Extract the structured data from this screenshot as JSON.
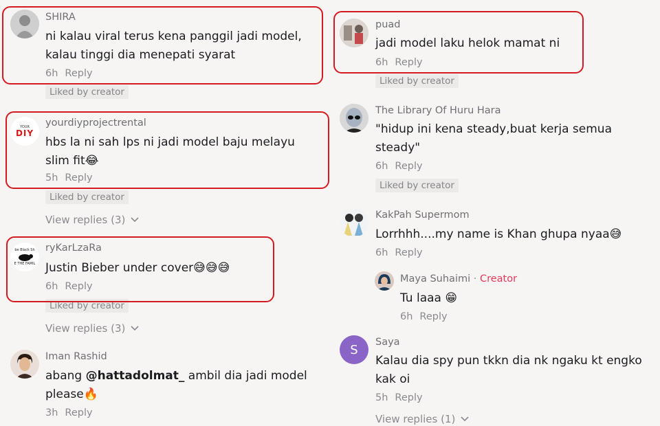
{
  "colors": {
    "highlight_border": "#d21a20",
    "creator_label": "#e5375a",
    "avatar_saya": "#8b64c8"
  },
  "left": [
    {
      "user": "SHIRA",
      "text": "ni kalau viral terus kena panggil jadi model, kalau tinggi dia menepati syarat",
      "time": "6h",
      "reply": "Reply",
      "liked": "Liked by creator"
    },
    {
      "user": "yourdiyprojectrental",
      "text": "hbs la ni sah lps ni jadi model baju melayu slim fit",
      "emoji": "😂",
      "time": "5h",
      "reply": "Reply",
      "liked": "Liked by creator",
      "view_replies": "View replies (3)"
    },
    {
      "user": "ryKarLzaRa",
      "text": "Justin Bieber under cover",
      "emoji": "😅😅😅",
      "time": "6h",
      "reply": "Reply",
      "liked": "Liked by creator",
      "view_replies": "View replies (3)"
    },
    {
      "user": "Iman Rashid",
      "text_pre": "abang ",
      "mention": "@hattadolmat_",
      "text_post": " ambil dia jadi model please",
      "emoji": "🔥",
      "time": "3h",
      "reply": "Reply"
    }
  ],
  "right": [
    {
      "user": "puad",
      "text": "jadi model laku helok mamat ni",
      "time": "6h",
      "reply": "Reply",
      "liked": "Liked by creator"
    },
    {
      "user": "The Library Of Huru Hara",
      "text": "\"hidup ini kena steady,buat kerja semua steady\"",
      "time": "6h",
      "reply": "Reply",
      "liked": "Liked by creator"
    },
    {
      "user": "KakPah Supermom",
      "text": "Lorrhhh....my name is Khan ghupa nyaa",
      "emoji": "😅",
      "time": "6h",
      "reply": "Reply"
    },
    {
      "user": "Maya Suhaimi",
      "dot": "·",
      "creator": "Creator",
      "text": "Tu laaa",
      "emoji": "😁",
      "time": "6h",
      "reply": "Reply"
    },
    {
      "user": "Saya",
      "avatar_letter": "S",
      "text": "Kalau dia spy pun tkkn dia nk ngaku kt engko kak oi",
      "time": "5h",
      "reply": "Reply",
      "view_replies": "View replies (1)"
    }
  ],
  "avatar_text": {
    "diy_top": "YOUR",
    "diy_main": "DIY",
    "ryk_top": "be Black Sh",
    "ryk_bottom": "E THE FAMIL"
  },
  "icons": {
    "chevron": "chevron-down-icon"
  }
}
